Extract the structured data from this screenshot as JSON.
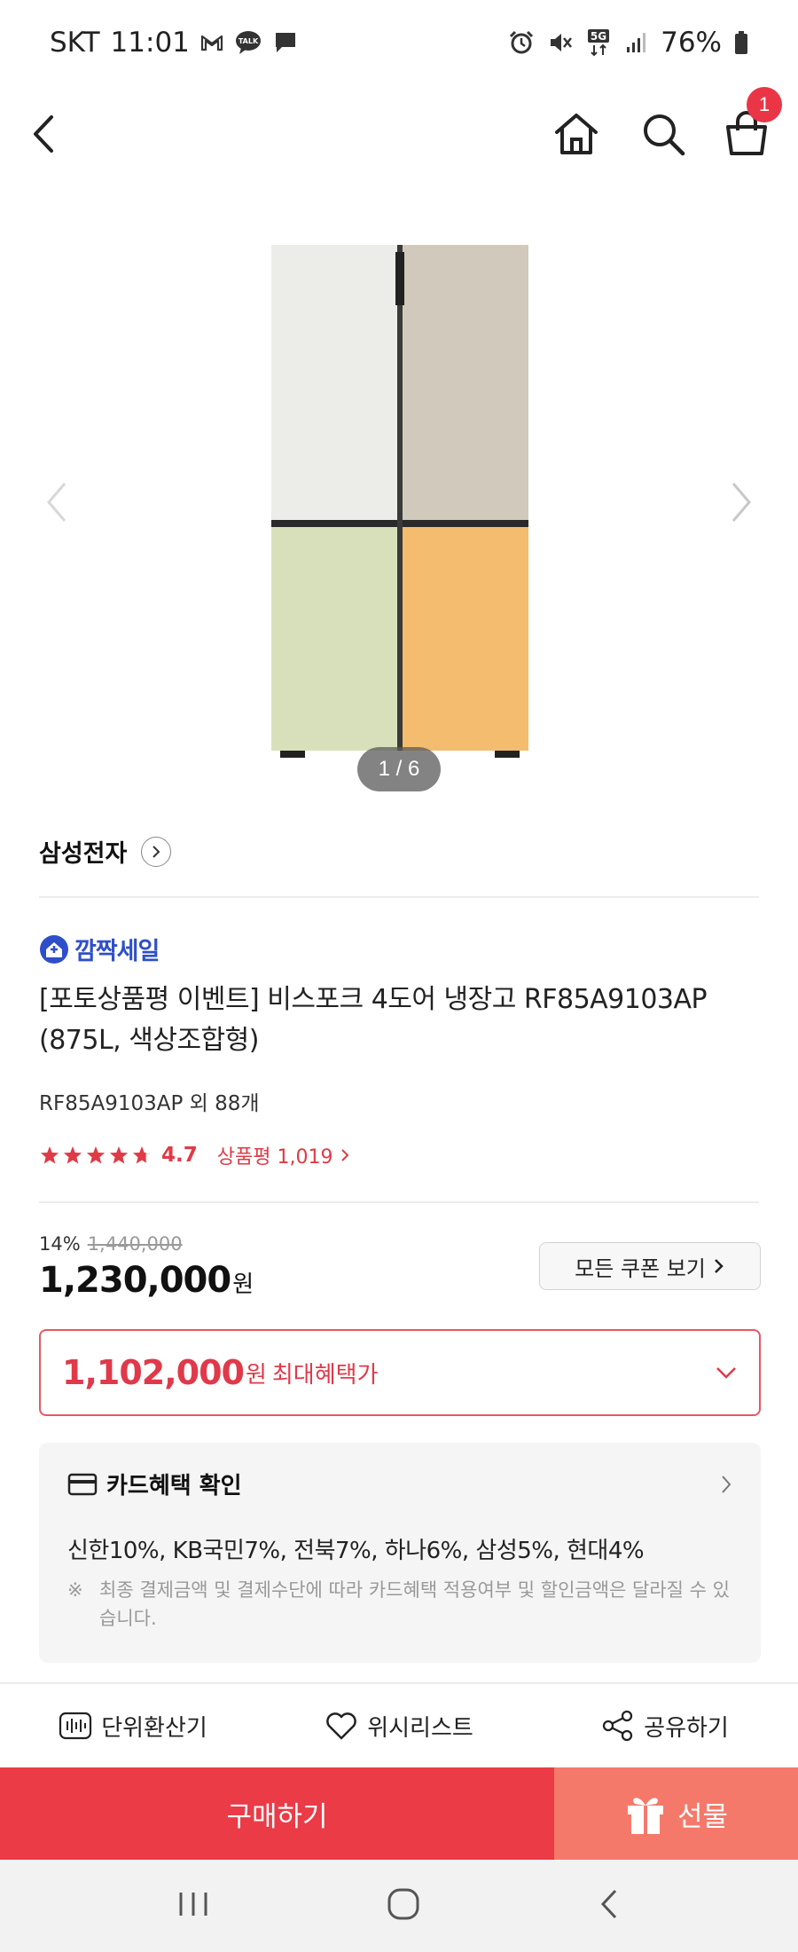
{
  "status_bar": {
    "carrier": "SKT",
    "time": "11:01",
    "battery": "76%",
    "left_icons": [
      "gmail-icon",
      "kakaotalk-icon",
      "message-icon"
    ],
    "right_icons": [
      "alarm-icon",
      "mute-icon",
      "5g-icon",
      "signal-icon",
      "battery-icon"
    ]
  },
  "nav": {
    "cart_count": "1"
  },
  "gallery": {
    "pager": "1 / 6",
    "image_colors": {
      "top_left": "#ecece8",
      "top_right": "#d2c9bd",
      "bottom_left": "#d8e0bb",
      "bottom_right": "#f3bc6f"
    }
  },
  "product": {
    "brand": "삼성전자",
    "sale_badge": "깜짝세일",
    "title": "[포토상품평 이벤트] 비스포크 4도어 냉장고 RF85A9103AP (875L, 색상조합형)",
    "model_line": "RF85A9103AP 외 88개",
    "rating": "4.7",
    "rating_stars": 4.7,
    "review_text": "상품평 1,019"
  },
  "price": {
    "discount_rate": "14%",
    "original": "1,440,000",
    "current": "1,230,000",
    "won": "원",
    "coupon_button": "모든 쿠폰 보기"
  },
  "benefit": {
    "price": "1,102,000",
    "won": "원",
    "label": "최대혜택가"
  },
  "card": {
    "title": "카드혜택 확인",
    "list": "신한10%, KB국민7%, 전북7%, 하나6%, 삼성5%, 현대4%",
    "note_mark": "※",
    "note": "최종 결제금액 및 결제수단에 따라 카드혜택 적용여부 및 할인금액은 달라질 수 있습니다."
  },
  "utilities": {
    "unit_converter": "단위환산기",
    "wishlist": "위시리스트",
    "share": "공유하기"
  },
  "actions": {
    "buy": "구매하기",
    "gift": "선물"
  },
  "colors": {
    "accent_red": "#ea3b47",
    "gift_salmon": "#f4796b",
    "sale_blue": "#2f4fc9"
  }
}
